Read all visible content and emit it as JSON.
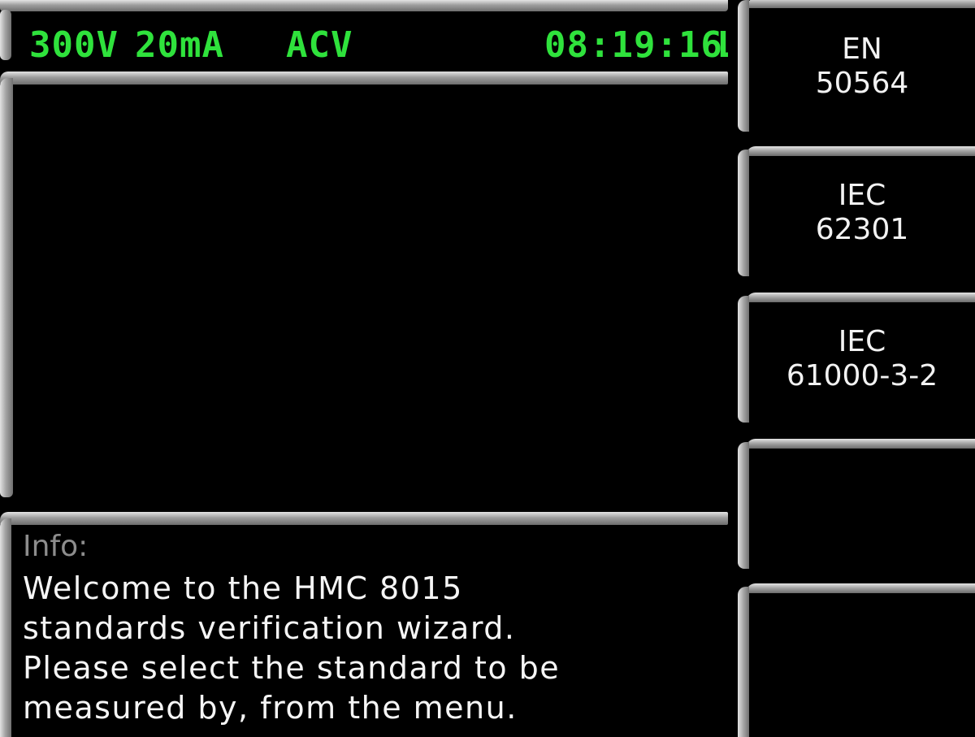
{
  "status_bar": {
    "voltage_range": "300V",
    "current_range": "20mA",
    "mode": "ACV",
    "time": "08:19:16",
    "clipped_char": "L"
  },
  "softkeys": [
    {
      "line1": "EN",
      "line2": "50564"
    },
    {
      "line1": "IEC",
      "line2": "62301"
    },
    {
      "line1": "IEC",
      "line2": "61000-3-2"
    },
    {
      "line1": "",
      "line2": ""
    },
    {
      "line1": "",
      "line2": ""
    }
  ],
  "info": {
    "title": "Info:",
    "lines": [
      "Welcome to the HMC 8015",
      "standards verification wizard.",
      "Please select the standard to be",
      "measured by, from the menu."
    ]
  },
  "colors": {
    "status_text": "#2fe23c",
    "background": "#000000",
    "frame": "#a0a0a0",
    "info_title": "#8d8d8d",
    "text": "#f5f5f5"
  }
}
